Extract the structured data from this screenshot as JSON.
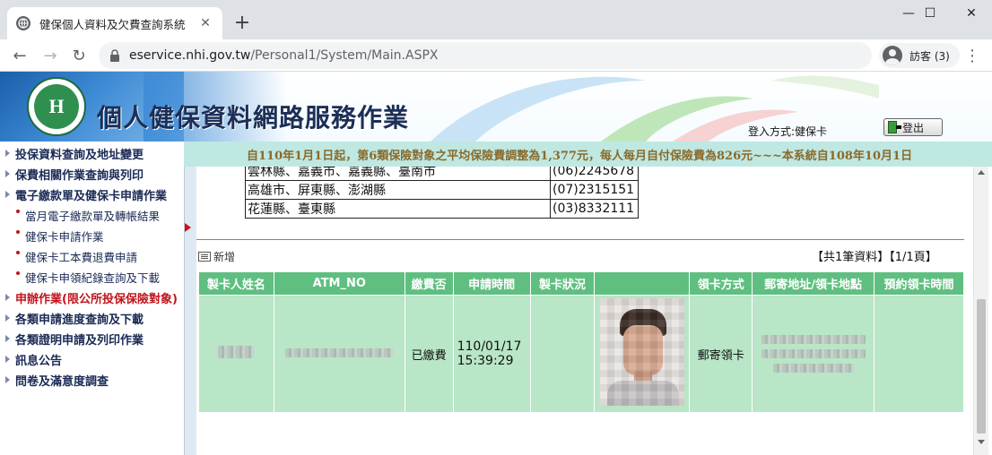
{
  "browser": {
    "tab_title": "健保個人資料及欠費查詢系統",
    "url_domain": "eservice.nhi.gov.tw",
    "url_path": "/Personal1/System/Main.ASPX",
    "profile_label": "訪客 (3)"
  },
  "header": {
    "site_title": "個人健保資料網路服務作業",
    "login_method": "登入方式:健保卡",
    "logout_label": "登出"
  },
  "marquee": {
    "text": "自110年1月1日起，第6類保險對象之平均保險費調整為1,377元，每人每月自付保險費為826元~~~本系統自108年10月1日"
  },
  "sidebar": {
    "items": [
      {
        "label": "投保資料查詢及地址變更"
      },
      {
        "label": "保費相關作業查詢與列印"
      },
      {
        "label": "電子繳款單及健保卡申請作業"
      },
      {
        "label": "當月電子繳款單及轉帳結果"
      },
      {
        "label": "健保卡申請作業"
      },
      {
        "label": "健保卡工本費退費申請"
      },
      {
        "label": "健保卡申領紀錄查詢及下載"
      },
      {
        "label": "申辦作業(限公所投保保險對象)"
      },
      {
        "label": "各類申請進度查詢及下載"
      },
      {
        "label": "各類證明申請及列印作業"
      },
      {
        "label": "訊息公告"
      },
      {
        "label": "問卷及滿意度調查"
      }
    ]
  },
  "contact_table": {
    "rows": [
      {
        "area": "雲林縣、嘉義市、嘉義縣、臺南市",
        "phone": "(06)2245678"
      },
      {
        "area": "高雄市、屏東縣、澎湖縣",
        "phone": "(07)2315151"
      },
      {
        "area": "花蓮縣、臺東縣",
        "phone": "(03)8332111"
      }
    ]
  },
  "records": {
    "add_label": "新增",
    "summary": "【共1筆資料】【1/1頁】",
    "headers": [
      "製卡人姓名",
      "ATM_NO",
      "繳費否",
      "申請時間",
      "製卡狀況",
      "",
      "領卡方式",
      "郵寄地址/領卡地點",
      "預約領卡時間"
    ],
    "rows": [
      {
        "paid": "已繳費",
        "apply_date": "110/01/17",
        "apply_time": "15:39:29",
        "pickup_method": "郵寄領卡"
      }
    ]
  }
}
